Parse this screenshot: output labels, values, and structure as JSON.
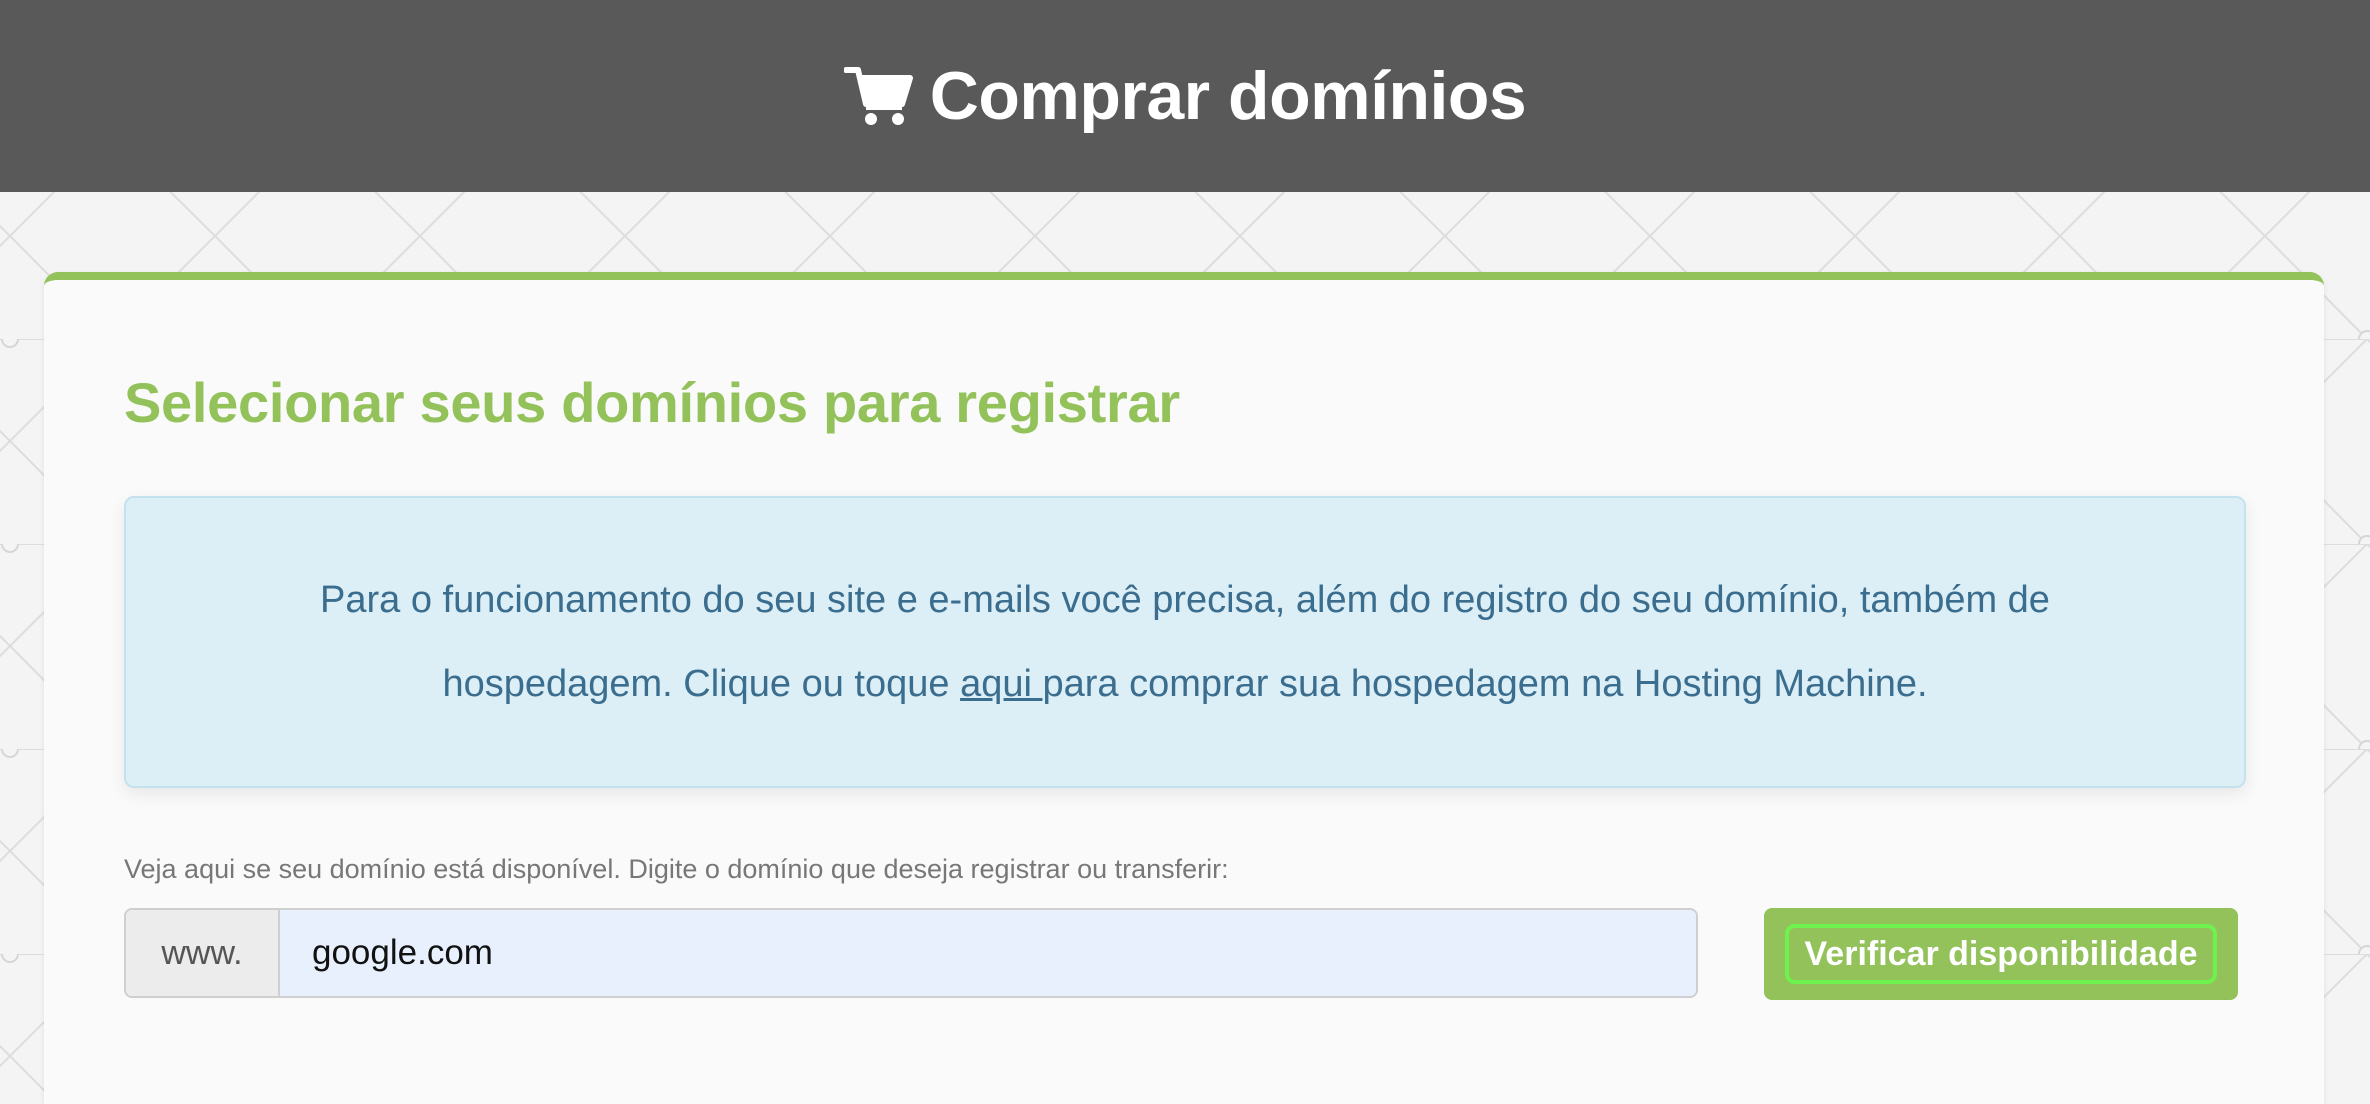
{
  "header": {
    "title": "Comprar domínios",
    "icon": "shopping-cart-icon",
    "background": "#595959"
  },
  "main": {
    "heading": "Selecionar seus domínios para registrar",
    "accent_color": "#93c25b",
    "info": {
      "text_before": "Para o funcionamento do seu site e e-mails você precisa, além do registro do seu domínio, também de hospedagem. Clique ou toque ",
      "link_label": "aqui ",
      "text_after": "para comprar sua hospedagem na Hosting Machine."
    },
    "search": {
      "label": "Veja aqui se seu domínio está disponível. Digite o domínio que deseja registrar ou transferir:",
      "prefix": "www.",
      "value": "google.com",
      "button_label": "Verificar disponibilidade"
    }
  }
}
